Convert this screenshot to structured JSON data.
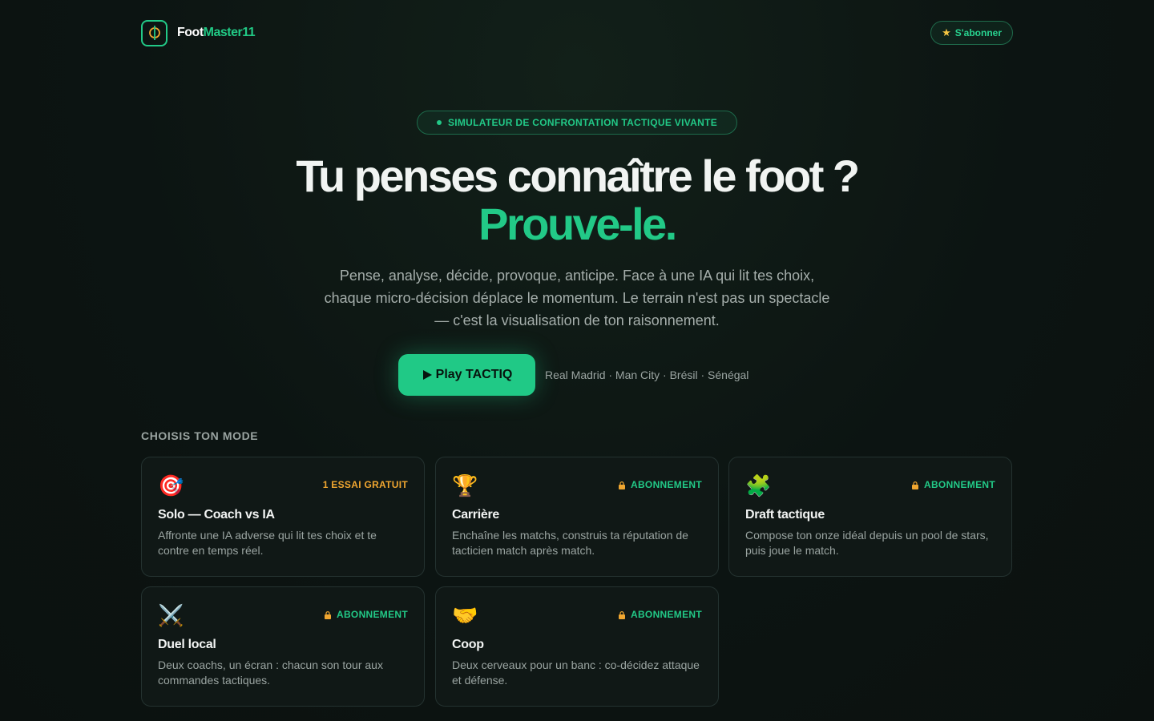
{
  "header": {
    "brand_part1": "Foot",
    "brand_part2": "Master11",
    "subscribe_label": "S'abonner"
  },
  "hero": {
    "tagline": "SIMULATEUR DE CONFRONTATION TACTIQUE VIVANTE",
    "headline_line1": "Tu penses connaître le foot ?",
    "headline_line2": "Prouve-le.",
    "lead_line1": "Pense, analyse, décide, provoque, anticipe. Face à une IA qui lit tes choix,",
    "lead_line2": "chaque micro-décision déplace le momentum. Le terrain n'est pas un spectacle",
    "lead_line3": "— c'est la visualisation de ton raisonnement.",
    "play_label": "Play TACTIQ",
    "teams": "Real Madrid · Man City · Brésil · Sénégal"
  },
  "modes": {
    "section_label": "CHOISIS TON MODE",
    "cards": [
      {
        "icon": "target-icon",
        "emoji": "🎯",
        "badge": "1 ESSAI GRATUIT",
        "title": "Solo — Coach vs IA",
        "desc": "Affronte une IA adverse qui lit tes choix et te contre en temps réel."
      },
      {
        "icon": "trophy-icon",
        "emoji": "🏆",
        "badge": "ABONNEMENT",
        "title": "Carrière",
        "desc": "Enchaîne les matchs, construis ta réputation de tacticien match après match."
      },
      {
        "icon": "puzzle-icon",
        "emoji": "🧩",
        "badge": "ABONNEMENT",
        "title": "Draft tactique",
        "desc": "Compose ton onze idéal depuis un pool de stars, puis joue le match."
      },
      {
        "icon": "crossed-swords-icon",
        "emoji": "⚔️",
        "badge": "ABONNEMENT",
        "title": "Duel local",
        "desc": "Deux coachs, un écran : chacun son tour aux commandes tactiques."
      },
      {
        "icon": "handshake-icon",
        "emoji": "🤝",
        "badge": "ABONNEMENT",
        "title": "Coop",
        "desc": "Deux cerveaux pour un banc : co-décidez attaque et défense."
      }
    ]
  },
  "colors": {
    "accent": "#22c987",
    "free_badge": "#f0a630",
    "background": "#0c1412"
  }
}
